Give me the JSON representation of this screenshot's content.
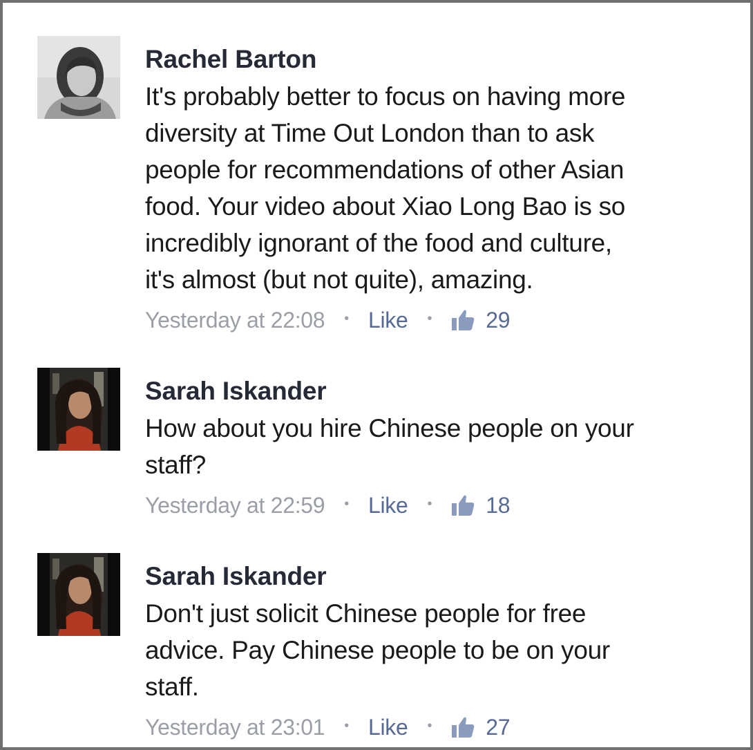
{
  "comments": [
    {
      "author": "Rachel Barton",
      "lines": [
        "It's probably better to focus on having more",
        "diversity at Time Out London than to ask",
        "people for recommendations of other Asian",
        "food.  Your video about Xiao Long Bao is so",
        "incredibly ignorant of the food and culture,",
        "it's almost (but not quite), amazing."
      ],
      "timestamp": "Yesterday at 22:08",
      "like_label": "Like",
      "like_count": "29",
      "avatar_icon": "user-avatar"
    },
    {
      "author": "Sarah Iskander",
      "lines": [
        "How about you hire Chinese people on your",
        "staff?"
      ],
      "timestamp": "Yesterday at 22:59",
      "like_label": "Like",
      "like_count": "18",
      "avatar_icon": "user-avatar"
    },
    {
      "author": "Sarah Iskander",
      "lines": [
        "Don't just solicit Chinese people for free",
        "advice.  Pay Chinese people to be on your",
        "staff."
      ],
      "timestamp": "Yesterday at 23:01",
      "like_label": "Like",
      "like_count": "27",
      "avatar_icon": "user-avatar"
    }
  ],
  "separator": "•",
  "colors": {
    "author": "#252a36",
    "text": "#1a1a1a",
    "meta": "#9a9ea6",
    "like": "#566a94",
    "border": "#6f6f6f"
  }
}
